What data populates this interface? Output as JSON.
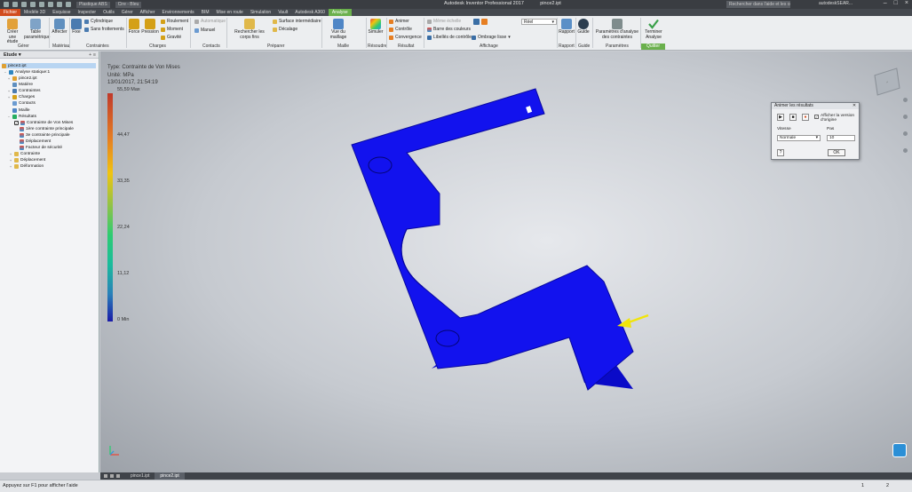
{
  "titlebar": {
    "combo1": "Plastique ABS",
    "combo2": "Cire - Bleu",
    "app_title": "Autodesk Inventor Professional 2017",
    "doc_title": "pince2.ipt",
    "search_placeholder": "Rechercher dans l'aide et les com",
    "user": "autodeskSEAR..."
  },
  "tabs": [
    "Fichier",
    "Modèle 3D",
    "Esquisse",
    "Inspecter",
    "Outils",
    "Gérer",
    "Afficher",
    "Environnements",
    "BIM",
    "Mise en route",
    "Simulation",
    "Vault",
    "Autodesk A360",
    "Analyse"
  ],
  "ribbon": {
    "gerer": {
      "creer": "Créer une étude",
      "table": "Table paramétrique",
      "label": "Gérer"
    },
    "materiau": {
      "affecter": "Affecter",
      "label": "Matériau"
    },
    "contraintes": {
      "fixe": "Fixe",
      "cylindrique": "Cylindrique",
      "sans_frottements": "Sans frottements",
      "label": "Contraintes"
    },
    "charges": {
      "force": "Force",
      "pression": "Pression",
      "roulement": "Roulement",
      "moment": "Moment",
      "gravite": "Gravité",
      "label": "Charges"
    },
    "contacts": {
      "automatique": "Automatique",
      "manuel": "Manuel",
      "label": "Contacts"
    },
    "preparer": {
      "rechercher": "Rechercher les corps fins",
      "surface": "Surface intermédiaire",
      "decalage": "Décalage",
      "label": "Préparer"
    },
    "maille": {
      "vue": "Vue du maillage",
      "label": "Maille"
    },
    "resoudre": {
      "simuler": "Simuler",
      "label": "Résoudre"
    },
    "resultat": {
      "animer": "Animer",
      "controle": "Contrôle",
      "convergence": "Convergence",
      "label": "Résultat"
    },
    "affichage": {
      "meme_echelle": "Même échelle",
      "barre": "Barre des couleurs",
      "libelles": "Libellés de contrôle",
      "ombrage": "Ombrage lisse",
      "reel": "Réel",
      "label": "Affichage"
    },
    "rapport": {
      "rapport": "Rapport",
      "label": "Rapport"
    },
    "guide": {
      "guide": "Guide",
      "label": "Guide"
    },
    "parametres": {
      "analyse": "Paramètres d'analyse des contraintes",
      "label": "Paramètres"
    },
    "quitter": {
      "terminer": "Terminer Analyse",
      "label": "Quitter"
    }
  },
  "browser": {
    "header": "Etude",
    "items": [
      "pince2.ipt",
      "Analyse statique:1",
      "pince2.ipt",
      "Matière",
      "Contraintes",
      "Charges",
      "Contacts",
      "Maille",
      "Résultats",
      "Contrainte de Von Mises",
      "1ère contrainte principale",
      "3e contrainte principale",
      "Déplacement",
      "Facteur de sécurité",
      "Contrainte",
      "Déplacement",
      "Déformation"
    ]
  },
  "legend": {
    "type": "Type: Contrainte de Von Mises",
    "unit": "Unité: MPa",
    "date": "13/01/2017, 21:54:19",
    "ticks": [
      "55,59 Max",
      "44,47",
      "33,35",
      "22,24",
      "11,12",
      "0 Min"
    ]
  },
  "dialog": {
    "title": "Animer les résultats",
    "show_origin": "Afficher la version d'origine",
    "vitesse_label": "Vitesse",
    "vitesse_value": "Normale",
    "pas_label": "Pas",
    "pas_value": "10",
    "ok": "OK"
  },
  "doctabs": [
    "pince1.ipt",
    "pince2.ipt"
  ],
  "status": {
    "help": "Appuyez sur F1 pour afficher l'aide",
    "right1": "1",
    "right2": "2"
  },
  "colors": {
    "part": "#1010e8",
    "accent": "#6ab04c",
    "file_tab": "#d14b1d"
  }
}
